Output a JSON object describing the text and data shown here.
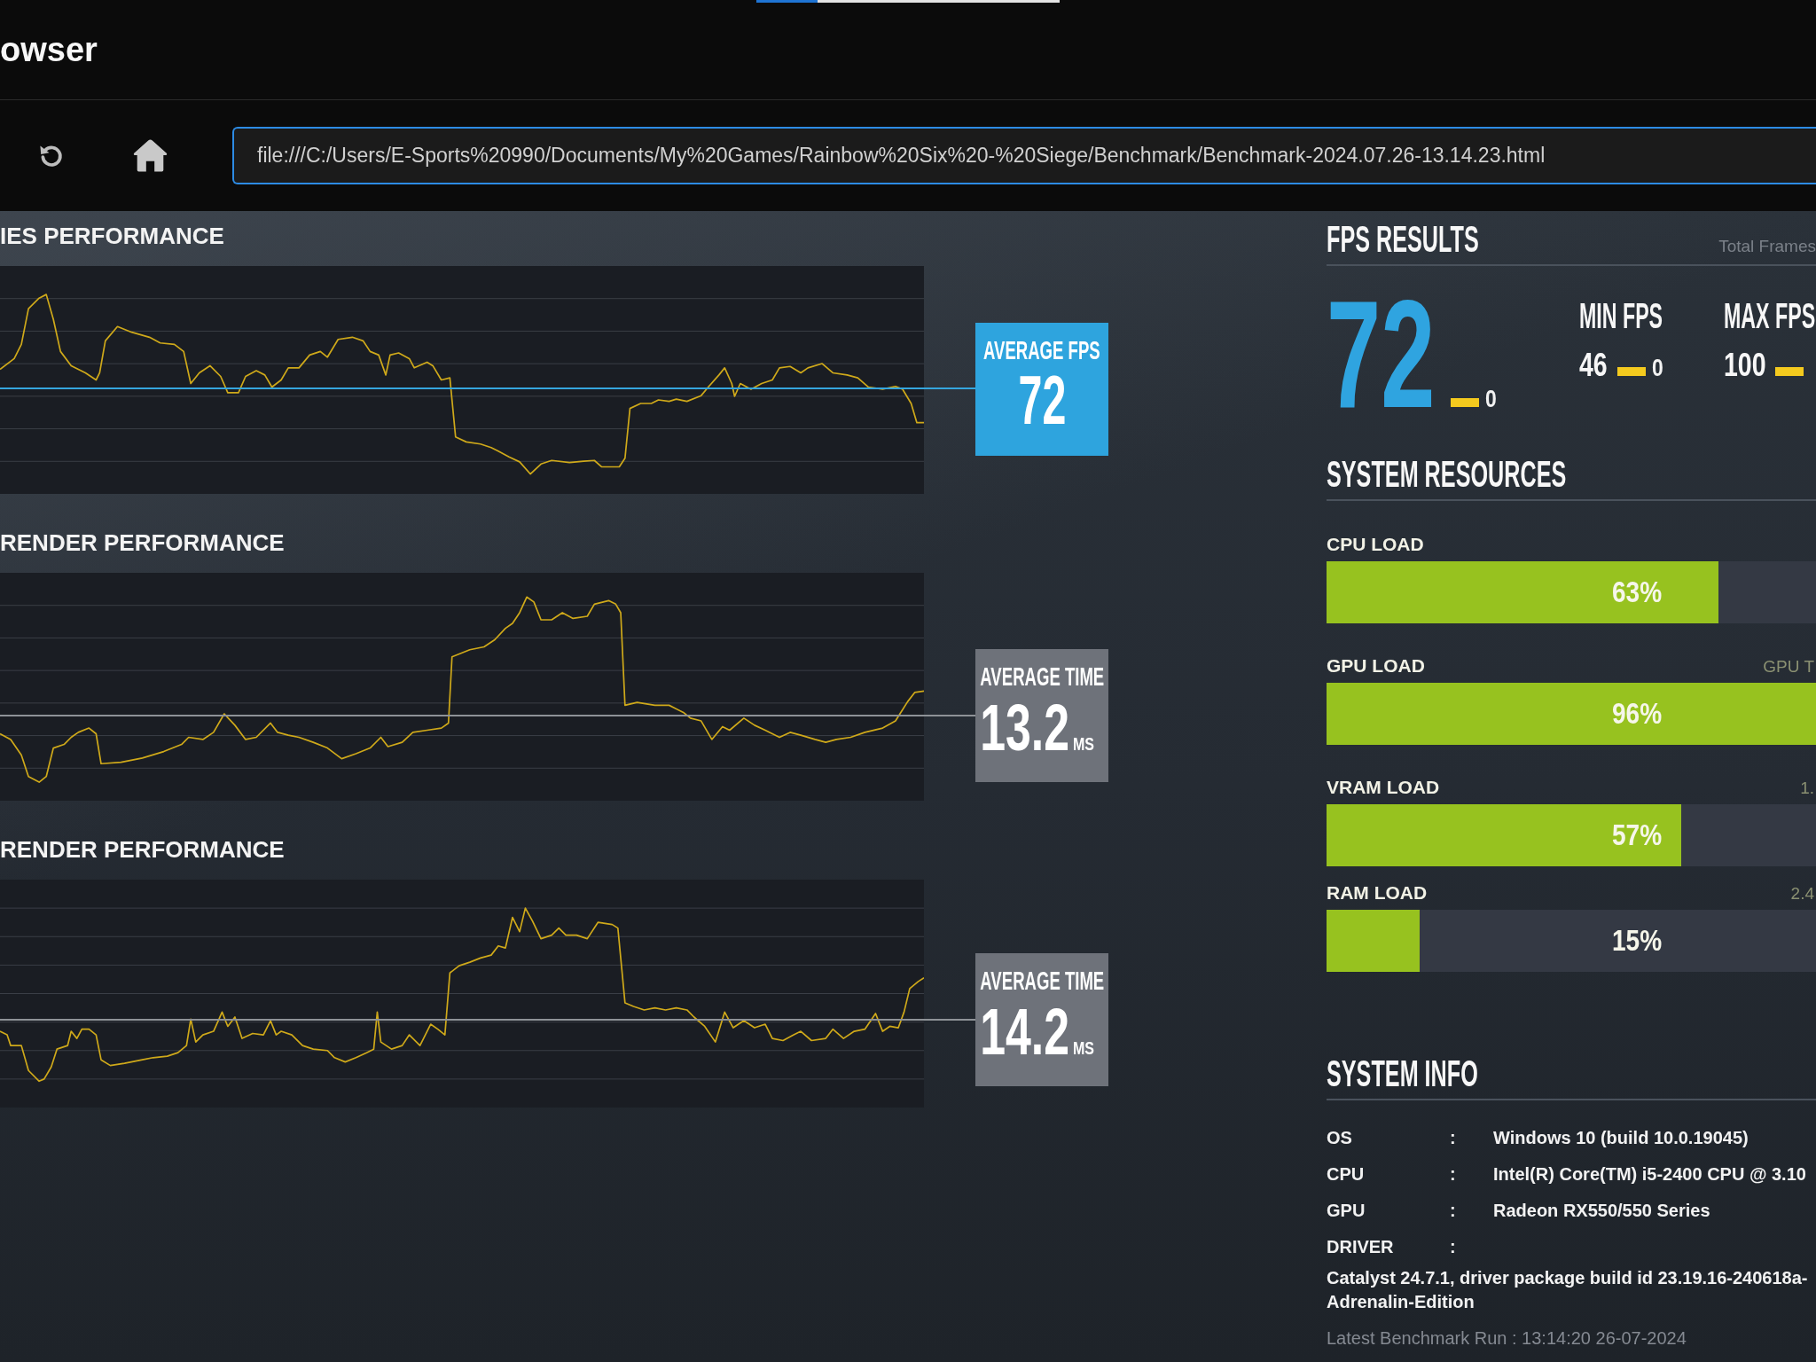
{
  "browser": {
    "title": "owser"
  },
  "toolbar": {
    "address": {
      "value": "file:///C:/Users/E-Sports%20990/Documents/My%20Games/Rainbow%20Six%20-%20Siege/Benchmark/Benchmark-2024.07.26-13.14.23.html"
    }
  },
  "performance_charts": [
    {
      "kind": "fps",
      "title": "IES PERFORMANCE",
      "average": {
        "label": "AVERAGE FPS",
        "value": "72"
      }
    },
    {
      "kind": "time",
      "title": "RENDER PERFORMANCE",
      "average": {
        "label": "AVERAGE TIME",
        "value": "13.2",
        "unit": "MS"
      }
    },
    {
      "kind": "time",
      "title": "RENDER PERFORMANCE",
      "average": {
        "label": "AVERAGE TIME",
        "value": "14.2",
        "unit": "MS"
      }
    }
  ],
  "fps_results": {
    "title": "FPS RESULTS",
    "total_frames_label": "Total Frames",
    "average": {
      "value": "72",
      "change": "0"
    },
    "stats": [
      {
        "label": "MIN FPS",
        "value": "46",
        "change": "0"
      },
      {
        "label": "MAX FPS",
        "value": "100"
      }
    ]
  },
  "system_resources": {
    "title": "SYSTEM RESOURCES",
    "items": [
      {
        "label": "CPU LOAD",
        "level": 0.63,
        "reading": "63%"
      },
      {
        "label": "GPU LOAD",
        "detail": "GPU T",
        "level": 0.96,
        "reading": "96%"
      },
      {
        "label": "VRAM LOAD",
        "detail": "1.",
        "level": 0.57,
        "reading": "57%"
      },
      {
        "label": "RAM LOAD",
        "detail": "2.4",
        "level": 0.15,
        "reading": "15%"
      }
    ]
  },
  "system_info": {
    "title": "SYSTEM INFO",
    "rows": [
      {
        "key": "OS",
        "separator": ":",
        "value": "Windows 10 (build 10.0.19045)"
      },
      {
        "key": "CPU",
        "separator": ":",
        "value": "Intel(R) Core(TM) i5-2400 CPU @ 3.10"
      },
      {
        "key": "GPU",
        "separator": ":",
        "value": "Radeon RX550/550 Series"
      },
      {
        "key": "DRIVER",
        "separator": ":",
        "value_lines": [
          "Catalyst 24.7.1, driver package build id 23.19.16-240618a-",
          "Adrenalin-Edition"
        ]
      }
    ],
    "latest_run": "Latest Benchmark Run : 13:14:20 26-07-2024"
  }
}
